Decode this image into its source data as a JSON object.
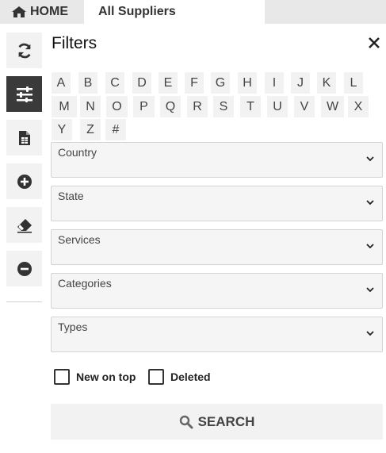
{
  "tabs": {
    "home_label": "HOME",
    "active_label": "All Suppliers"
  },
  "rail": {
    "items": [
      {
        "icon": "refresh-icon"
      },
      {
        "icon": "sliders-icon",
        "active": true
      },
      {
        "icon": "spreadsheet-icon"
      },
      {
        "icon": "plus-circle-icon"
      },
      {
        "icon": "eraser-icon"
      },
      {
        "icon": "minus-circle-icon"
      }
    ]
  },
  "filters": {
    "title": "Filters",
    "letters": [
      "A",
      "B",
      "C",
      "D",
      "E",
      "F",
      "G",
      "H",
      "I",
      "J",
      "K",
      "L",
      "M",
      "N",
      "O",
      "P",
      "Q",
      "R",
      "S",
      "T",
      "U",
      "V",
      "W",
      "X",
      "Y",
      "Z",
      "#"
    ],
    "dropdowns": [
      {
        "label": "Country"
      },
      {
        "label": "State"
      },
      {
        "label": "Services"
      },
      {
        "label": "Categories"
      },
      {
        "label": "Types"
      }
    ],
    "new_on_top_label": "New on top",
    "deleted_label": "Deleted",
    "search_label": "SEARCH"
  },
  "colors": {
    "tabbar_bg": "#e8e8e8",
    "rail_active_bg": "#3a3a3a",
    "button_bg": "#f2f2f2"
  }
}
